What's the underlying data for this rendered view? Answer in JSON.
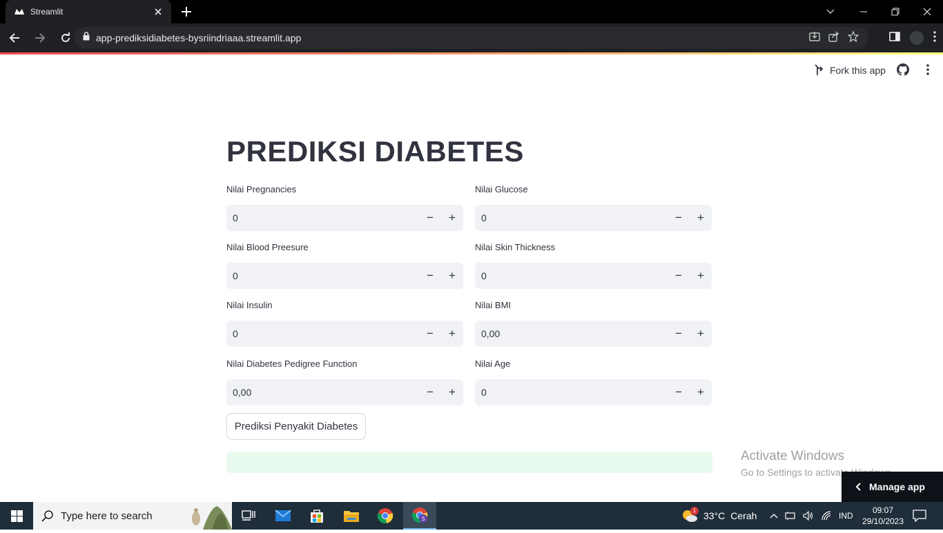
{
  "browser": {
    "tab_title": "Streamlit",
    "url": "app-prediksidiabetes-bysriindriaaa.streamlit.app"
  },
  "app": {
    "fork_label": "Fork this app",
    "title": "PREDIKSI DIABETES",
    "fields": [
      {
        "label": "Nilai Pregnancies",
        "value": "0"
      },
      {
        "label": "Nilai Glucose",
        "value": "0"
      },
      {
        "label": "Nilai Blood Preesure",
        "value": "0"
      },
      {
        "label": "Nilai Skin Thickness",
        "value": "0"
      },
      {
        "label": "Nilai Insulin",
        "value": "0"
      },
      {
        "label": "Nilai BMI",
        "value": "0,00"
      },
      {
        "label": "Nilai Diabetes Pedigree Function",
        "value": "0,00"
      },
      {
        "label": "Nilai Age",
        "value": "0"
      }
    ],
    "predict_button": "Prediksi Penyakit Diabetes",
    "manage_app": "Manage app",
    "accent_color": "#ff4b4b",
    "success_color": "#e8f9ee"
  },
  "watermark": {
    "line1": "Activate Windows",
    "line2": "Go to Settings to activate Windows."
  },
  "taskbar": {
    "search_placeholder": "Type here to search",
    "weather_temp": "33°C",
    "weather_text": "Cerah",
    "weather_badge": "1",
    "language": "IND",
    "time": "09:07",
    "date": "29/10/2023"
  }
}
